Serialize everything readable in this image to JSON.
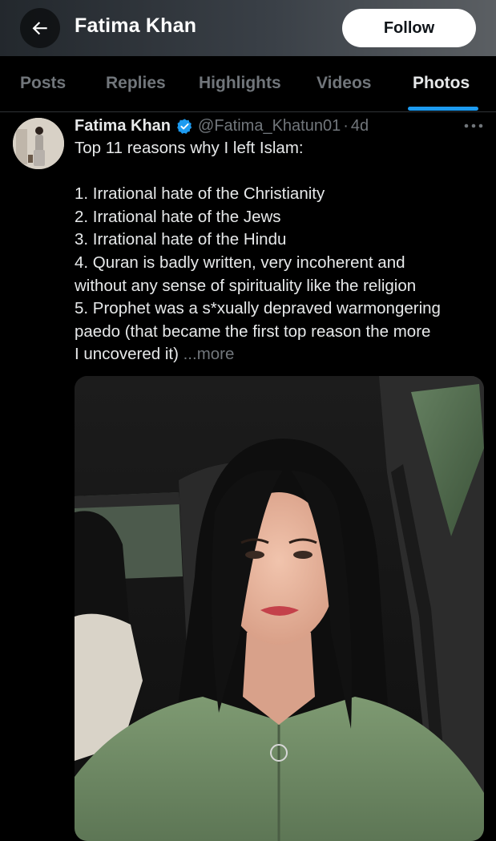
{
  "header": {
    "title": "Fatima Khan",
    "back_icon": "arrow-left-icon",
    "follow_label": "Follow"
  },
  "tabs": [
    {
      "label": "Posts",
      "active": false
    },
    {
      "label": "Replies",
      "active": false
    },
    {
      "label": "Highlights",
      "active": false
    },
    {
      "label": "Videos",
      "active": false
    },
    {
      "label": "Photos",
      "active": true
    }
  ],
  "colors": {
    "accent": "#1d9bf0",
    "background": "#000000",
    "text_primary": "#e7e9ea",
    "text_secondary": "#71767b"
  },
  "tweet": {
    "author_name": "Fatima Khan",
    "verified_icon": "verified-badge-icon",
    "handle": "@Fatima_Khatun01",
    "separator": "·",
    "time": "4d",
    "more_icon": "more-horizontal-icon",
    "lines": [
      "Top 11 reasons why I left Islam:",
      "",
      "1. Irrational hate of the Christianity",
      "2. Irrational hate of the Jews",
      "3. Irrational hate of the Hindu",
      "4. Quran is badly written, very incoherent and",
      "without any sense of spirituality like the religion",
      "5. Prophet was a s*xually depraved warmongering",
      "paedo (that became the first top reason the more",
      "I uncovered it)"
    ],
    "more_label": "...more"
  }
}
